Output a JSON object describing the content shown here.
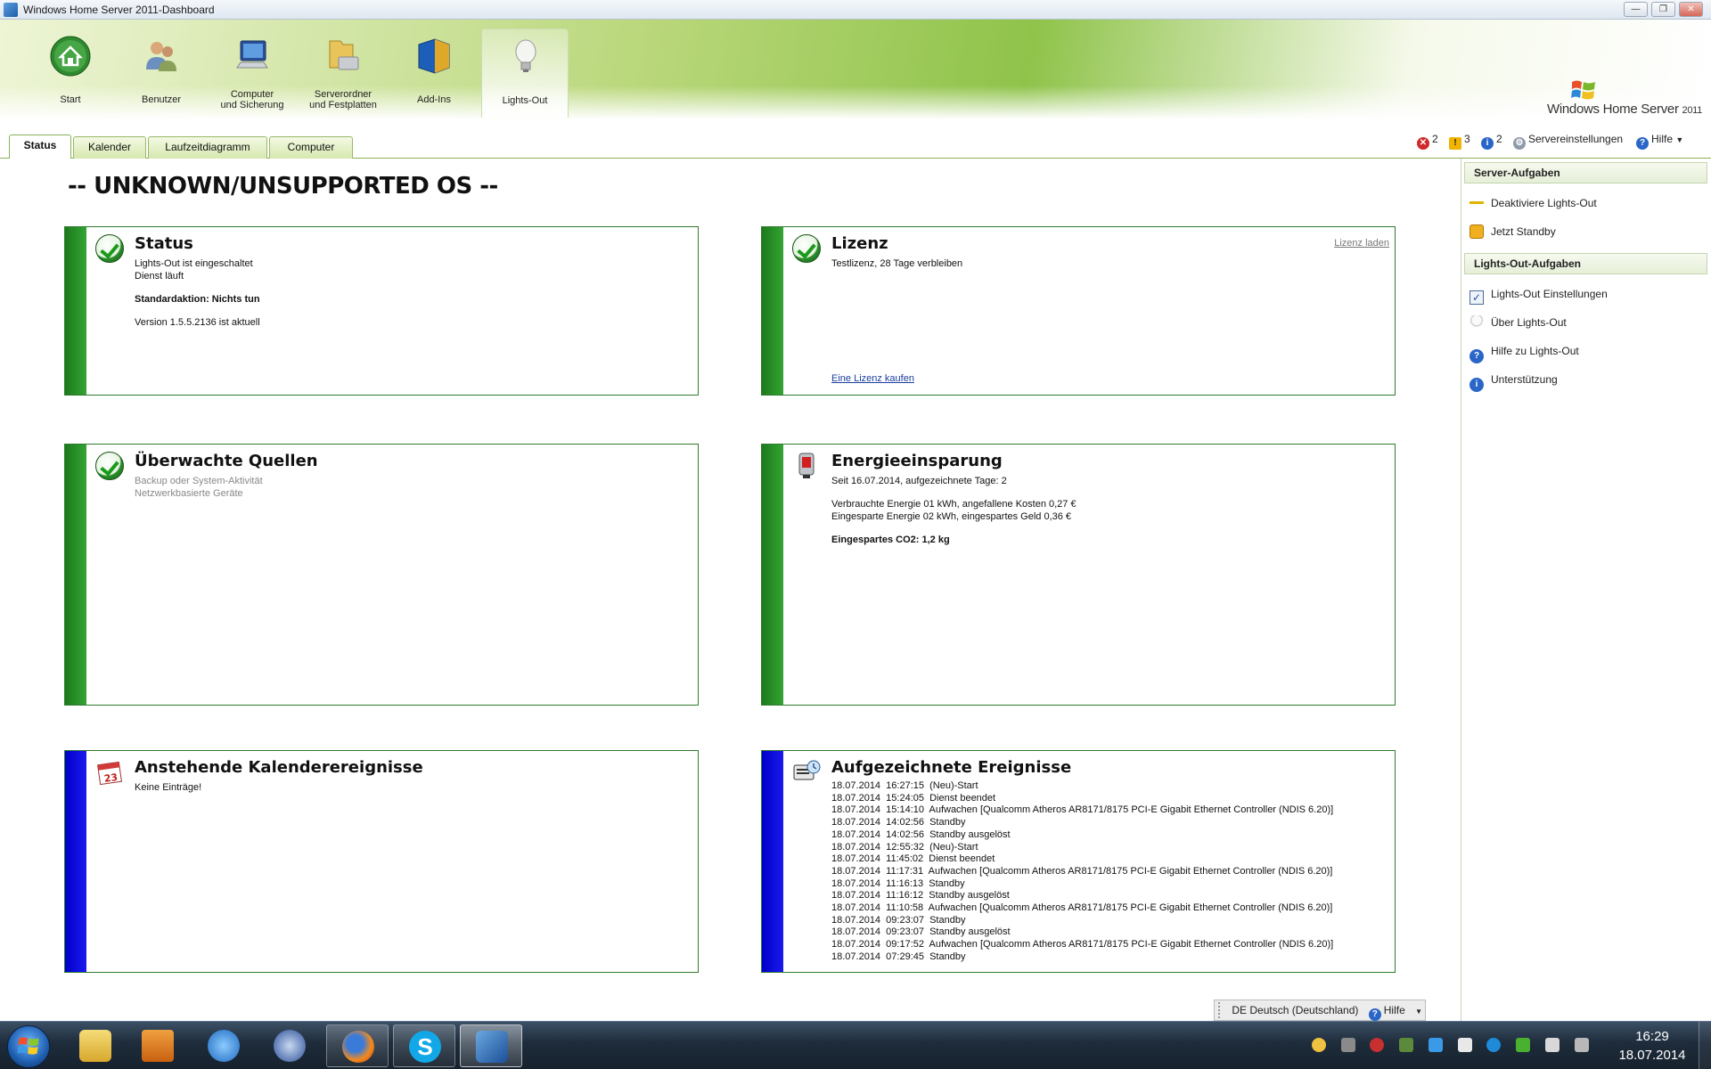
{
  "window": {
    "title": "Windows Home Server 2011-Dashboard",
    "controls": [
      "—",
      "❐",
      "✕"
    ]
  },
  "nav": [
    {
      "label_1": "Start",
      "label_2": "",
      "icon": "home-icon"
    },
    {
      "label_1": "Benutzer",
      "label_2": "",
      "icon": "users-icon"
    },
    {
      "label_1": "Computer",
      "label_2": "und Sicherung",
      "icon": "computer-icon"
    },
    {
      "label_1": "Serverordner",
      "label_2": "und Festplatten",
      "icon": "folder-icon"
    },
    {
      "label_1": "Add-Ins",
      "label_2": "",
      "icon": "addins-icon"
    },
    {
      "label_1": "Lights-Out",
      "label_2": "",
      "icon": "lightbulb-icon",
      "active": true
    }
  ],
  "brand": {
    "name": "Windows Home Server",
    "version": "2011"
  },
  "tabs": [
    {
      "label": "Status",
      "active": true
    },
    {
      "label": "Kalender"
    },
    {
      "label": "Laufzeitdiagramm"
    },
    {
      "label": "Computer"
    }
  ],
  "alerts": {
    "critical": "2",
    "warning": "3",
    "info": "2",
    "settings_label": "Servereinstellungen",
    "help_label": "Hilfe"
  },
  "os_title": "-- UNKNOWN/UNSUPPORTED OS --",
  "cards": {
    "status": {
      "title": "Status",
      "line1": "Lights-Out ist eingeschaltet",
      "line2": "Dienst läuft",
      "default_action": "Standardaktion: Nichts tun",
      "version": "Version 1.5.5.2136  ist aktuell"
    },
    "license": {
      "title": "Lizenz",
      "text": "Testlizenz, 28 Tage verbleiben",
      "load_link": "Lizenz laden",
      "buy_link": "Eine Lizenz kaufen"
    },
    "sources": {
      "title": "Überwachte Quellen",
      "line1": "Backup oder System-Aktivität",
      "line2": "Netzwerkbasierte Geräte"
    },
    "energy": {
      "title": "Energieeinsparung",
      "since": "Seit 16.07.2014,  aufgezeichnete Tage: 2",
      "used": "Verbrauchte Energie 01 kWh, angefallene Kosten 0,27 €",
      "saved": "Eingesparte Energie 02 kWh, eingespartes Geld 0,36 €",
      "co2": "Eingespartes CO2:  1,2 kg"
    },
    "calendar": {
      "title": "Anstehende Kalenderereignisse",
      "text": "Keine Einträge!",
      "icon_day": "23"
    },
    "events": {
      "title": "Aufgezeichnete Ereignisse",
      "items": [
        "18.07.2014  16:27:15  (Neu)-Start",
        "18.07.2014  15:24:05  Dienst beendet",
        "18.07.2014  15:14:10  Aufwachen [Qualcomm Atheros AR8171/8175 PCI-E Gigabit Ethernet Controller (NDIS 6.20)]",
        "18.07.2014  14:02:56  Standby",
        "18.07.2014  14:02:56  Standby ausgelöst",
        "18.07.2014  12:55:32  (Neu)-Start",
        "18.07.2014  11:45:02  Dienst beendet",
        "18.07.2014  11:17:31  Aufwachen [Qualcomm Atheros AR8171/8175 PCI-E Gigabit Ethernet Controller (NDIS 6.20)]",
        "18.07.2014  11:16:13  Standby",
        "18.07.2014  11:16:12  Standby ausgelöst",
        "18.07.2014  11:10:58  Aufwachen [Qualcomm Atheros AR8171/8175 PCI-E Gigabit Ethernet Controller (NDIS 6.20)]",
        "18.07.2014  09:23:07  Standby",
        "18.07.2014  09:23:07  Standby ausgelöst",
        "18.07.2014  09:17:52  Aufwachen [Qualcomm Atheros AR8171/8175 PCI-E Gigabit Ethernet Controller (NDIS 6.20)]",
        "18.07.2014  07:29:45  Standby"
      ]
    }
  },
  "sidebar": {
    "server_header": "Server-Aufgaben",
    "server_items": [
      "Deaktiviere Lights-Out",
      "Jetzt Standby"
    ],
    "lo_header": "Lights-Out-Aufgaben",
    "lo_items": [
      "Lights-Out Einstellungen",
      "Über Lights-Out",
      "Hilfe zu Lights-Out",
      "Unterstützung"
    ]
  },
  "langbar": {
    "lang": "DE Deutsch (Deutschland)",
    "help": "Hilfe"
  },
  "taskbar": {
    "time": "16:29",
    "date": "18.07.2014"
  },
  "colors": {
    "status_bar_green": "#2a8a2a",
    "events_bar_blue": "#0000d0",
    "ribbon_green": "#8fc34a"
  }
}
